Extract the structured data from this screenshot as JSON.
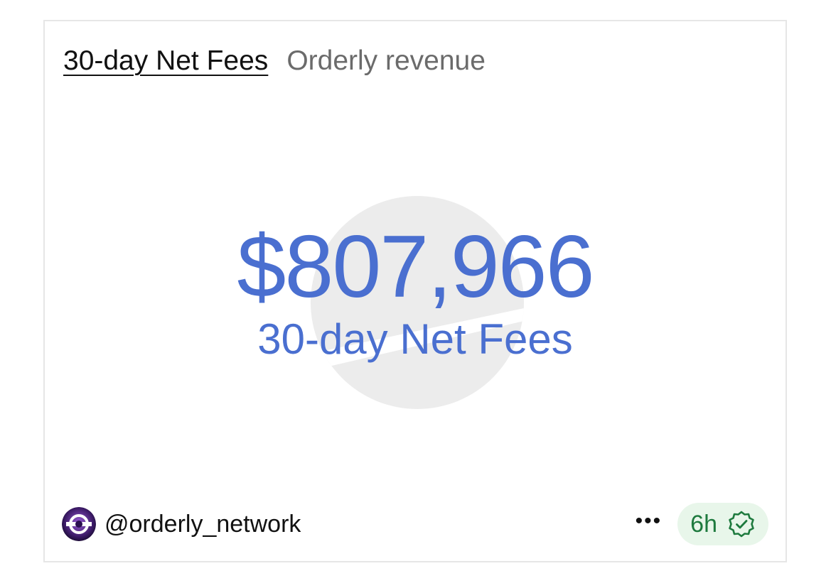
{
  "header": {
    "title": "30-day Net Fees",
    "subtitle": "Orderly revenue"
  },
  "metric": {
    "value": "$807,966",
    "label": "30-day Net Fees"
  },
  "footer": {
    "handle": "@orderly_network",
    "more_label": "•••",
    "time_badge": "6h",
    "badge_icon": "verified-check-icon"
  },
  "colors": {
    "metric": "#4a6fd0",
    "badge_bg": "#e8f6ea",
    "badge_text": "#1e7a3e",
    "watermark": "#ececec"
  }
}
